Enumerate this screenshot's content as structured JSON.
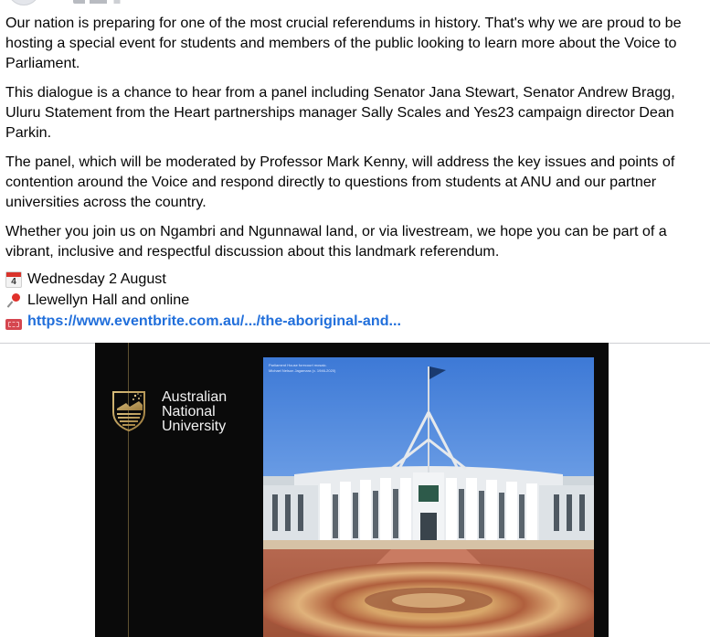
{
  "post": {
    "paragraphs": [
      "Our nation is preparing for one of the most crucial referendums in history. That's why we are proud to be hosting a special event for students and members of the public looking to learn more about the Voice to Parliament.",
      "This dialogue is a chance to hear from a panel including Senator Jana Stewart, Senator Andrew Bragg, Uluru Statement from the Heart partnerships manager Sally Scales and Yes23 campaign director Dean Parkin.",
      "The panel, which will be moderated by Professor Mark Kenny, will address the key issues and points of contention around the Voice and respond directly to questions from students at ANU and our partner universities across the country.",
      "Whether you join us on Ngambri and Ngunnawal land, or via livestream, we hope you can be part of a vibrant, inclusive and respectful discussion about this landmark referendum."
    ],
    "date": "Wednesday 2 August",
    "calendar_day": "4",
    "location": "Llewellyn Hall and online",
    "link": "https://www.eventbrite.com.au/.../the-aboriginal-and..."
  },
  "icons": {
    "date": "calendar-icon",
    "location": "round-pushpin-icon",
    "link": "ticket-icon"
  },
  "media": {
    "org_name_line1": "Australian",
    "org_name_line2": "National",
    "org_name_line3": "University",
    "caption_line1": "Parliament House forecourt mosaic.",
    "caption_line2": "Michael Nelson Jagamara (c. 1946-2020)"
  },
  "colors": {
    "link": "#216fdb",
    "media_bg": "#0a0a0a",
    "gold": "#b89b5e"
  }
}
